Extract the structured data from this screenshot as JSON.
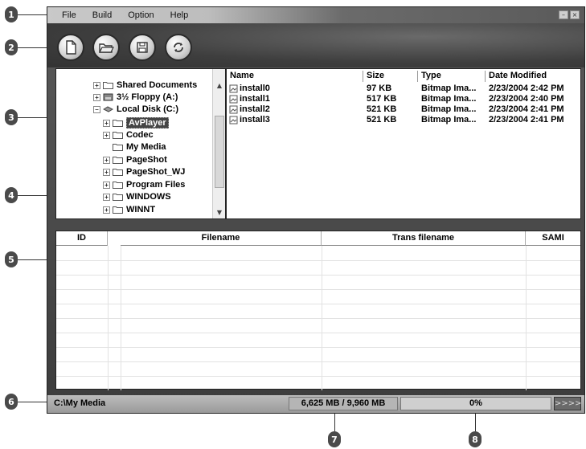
{
  "callouts": [
    "1",
    "2",
    "3",
    "4",
    "5",
    "6",
    "7",
    "8"
  ],
  "menu": [
    "File",
    "Build",
    "Option",
    "Help"
  ],
  "window_buttons": [
    "–",
    "×"
  ],
  "toolbar": {
    "buttons": [
      {
        "icon": "new-document-icon"
      },
      {
        "icon": "open-folder-icon"
      },
      {
        "icon": "save-disk-icon"
      },
      {
        "icon": "refresh-icon"
      }
    ]
  },
  "tree": {
    "items": [
      {
        "label": "Shared Documents",
        "expander": "+",
        "icon": "folder-icon"
      },
      {
        "label": "3½ Floppy (A:)",
        "expander": "+",
        "icon": "floppy-drive-icon"
      },
      {
        "label": "Local Disk (C:)",
        "expander": "–",
        "icon": "hard-disk-icon"
      },
      {
        "label": "AvPlayer",
        "expander": "+",
        "icon": "folder-icon",
        "selected": true
      },
      {
        "label": "Codec",
        "expander": "+",
        "icon": "folder-icon"
      },
      {
        "label": "My Media",
        "expander": "",
        "icon": "folder-icon"
      },
      {
        "label": "PageShot",
        "expander": "+",
        "icon": "folder-icon"
      },
      {
        "label": "PageShot_WJ",
        "expander": "+",
        "icon": "folder-icon"
      },
      {
        "label": "Program Files",
        "expander": "+",
        "icon": "folder-icon"
      },
      {
        "label": "WINDOWS",
        "expander": "+",
        "icon": "folder-icon"
      },
      {
        "label": "WINNT",
        "expander": "+",
        "icon": "folder-icon"
      }
    ]
  },
  "files": {
    "columns": [
      "Name",
      "Size",
      "Type",
      "Date Modified"
    ],
    "rows": [
      [
        "install0",
        "97 KB",
        "Bitmap Ima...",
        "2/23/2004 2:42 PM"
      ],
      [
        "install1",
        "517 KB",
        "Bitmap Ima...",
        "2/23/2004 2:40 PM"
      ],
      [
        "install2",
        "521 KB",
        "Bitmap Ima...",
        "2/23/2004 2:41 PM"
      ],
      [
        "install3",
        "521 KB",
        "Bitmap Ima...",
        "2/23/2004 2:41 PM"
      ]
    ]
  },
  "jobs": {
    "columns": [
      "ID",
      "Filename",
      "Trans filename",
      "SAMI"
    ],
    "rows": []
  },
  "status": {
    "path": "C:\\My Media",
    "disk": "6,625 MB / 9,960 MB",
    "progress_label": "0%",
    "progress_fraction": 0,
    "go_label": ">>>>"
  }
}
